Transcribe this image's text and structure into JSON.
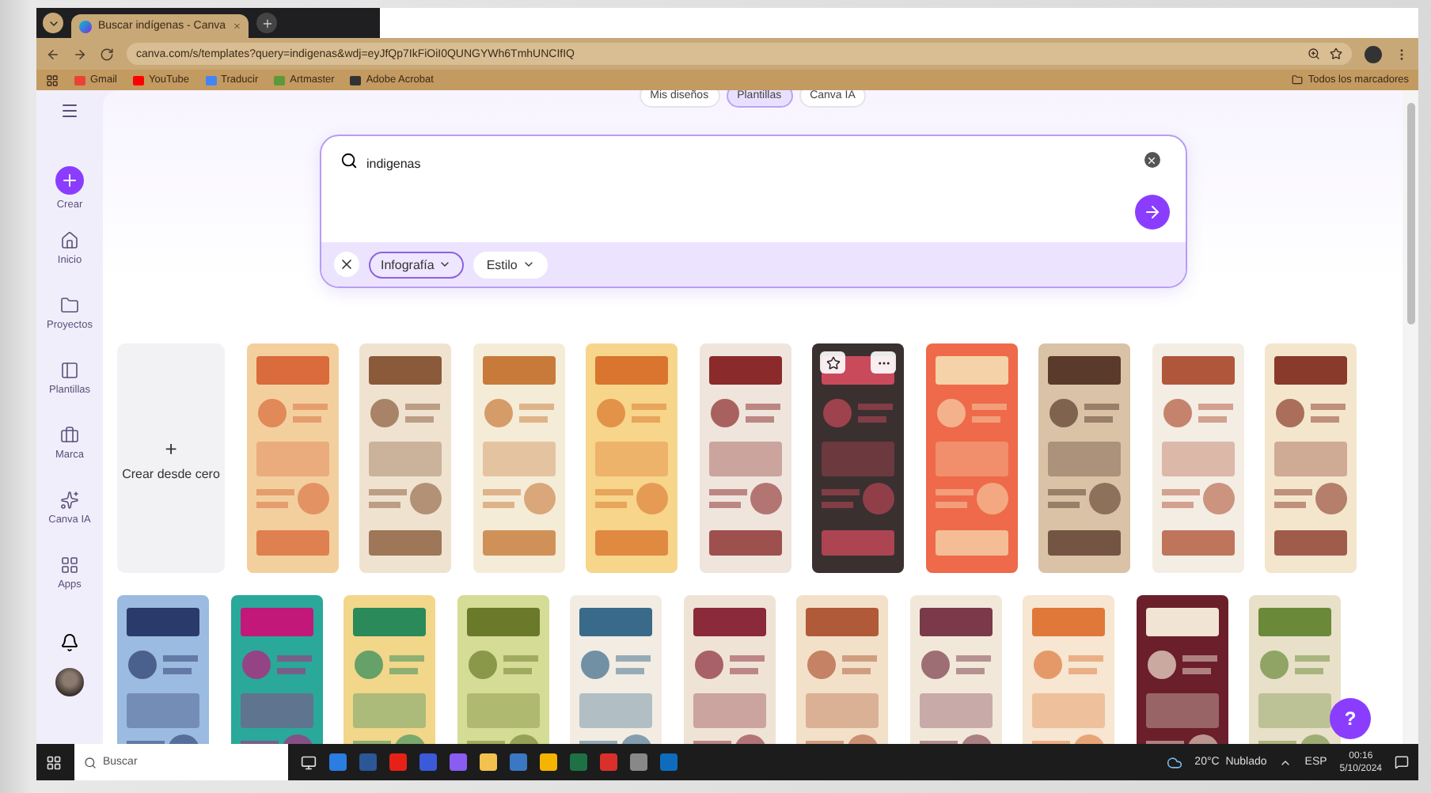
{
  "browser": {
    "tab_title": "Buscar indígenas - Canva",
    "url": "canva.com/s/templates?query=indigenas&wdj=eyJfQp7IkFiOiI0QUNGYWh6TmhUNCIfIQ",
    "bookmarks": [
      "Gmail",
      "YouTube",
      "Traducir",
      "Artmaster",
      "Adobe Acrobat"
    ],
    "all_bookmarks": "Todos los marcadores"
  },
  "sidebar": {
    "items": [
      {
        "label": "Crear",
        "kind": "create"
      },
      {
        "label": "Inicio",
        "kind": "home"
      },
      {
        "label": "Proyectos",
        "kind": "projects"
      },
      {
        "label": "Plantillas",
        "kind": "templates"
      },
      {
        "label": "Marca",
        "kind": "brand"
      },
      {
        "label": "Canva IA",
        "kind": "ai"
      },
      {
        "label": "Apps",
        "kind": "apps"
      }
    ]
  },
  "top_tabs": [
    {
      "label": "Mis diseños",
      "selected": false
    },
    {
      "label": "Plantillas",
      "selected": true
    },
    {
      "label": "Canva IA",
      "selected": false
    }
  ],
  "search": {
    "value": "indigenas",
    "filters": [
      {
        "label": "Infografía",
        "selected": true
      },
      {
        "label": "Estilo",
        "selected": false
      }
    ]
  },
  "create_blank": {
    "label": "Crear desde cero",
    "icon": "+"
  },
  "template_rows": [
    [
      {
        "kind": "picture",
        "hovered": false
      },
      {
        "kind": "picture",
        "hovered": false
      },
      {
        "kind": "picture",
        "hovered": false
      },
      {
        "kind": "picture",
        "hovered": false
      },
      {
        "kind": "picture",
        "hovered": false
      },
      {
        "kind": "picture",
        "hovered": true
      },
      {
        "kind": "picture",
        "hovered": false
      },
      {
        "kind": "picture",
        "hovered": false
      },
      {
        "kind": "picture",
        "hovered": false
      },
      {
        "kind": "picture",
        "hovered": false
      }
    ],
    [
      {
        "kind": "picture",
        "hovered": false
      },
      {
        "kind": "picture",
        "hovered": false
      },
      {
        "kind": "picture",
        "hovered": false
      },
      {
        "kind": "picture",
        "hovered": false
      },
      {
        "kind": "picture",
        "hovered": false
      },
      {
        "kind": "picture",
        "hovered": false
      },
      {
        "kind": "picture",
        "hovered": false
      },
      {
        "kind": "picture",
        "hovered": false
      },
      {
        "kind": "picture",
        "hovered": false
      },
      {
        "kind": "picture",
        "hovered": false
      },
      {
        "kind": "picture",
        "hovered": false
      }
    ]
  ],
  "help_button": "?",
  "taskbar": {
    "search_placeholder": "Buscar",
    "weather": "20°C  Nublado",
    "language": "ESP",
    "time": "00:16",
    "date": "5/10/2024"
  }
}
